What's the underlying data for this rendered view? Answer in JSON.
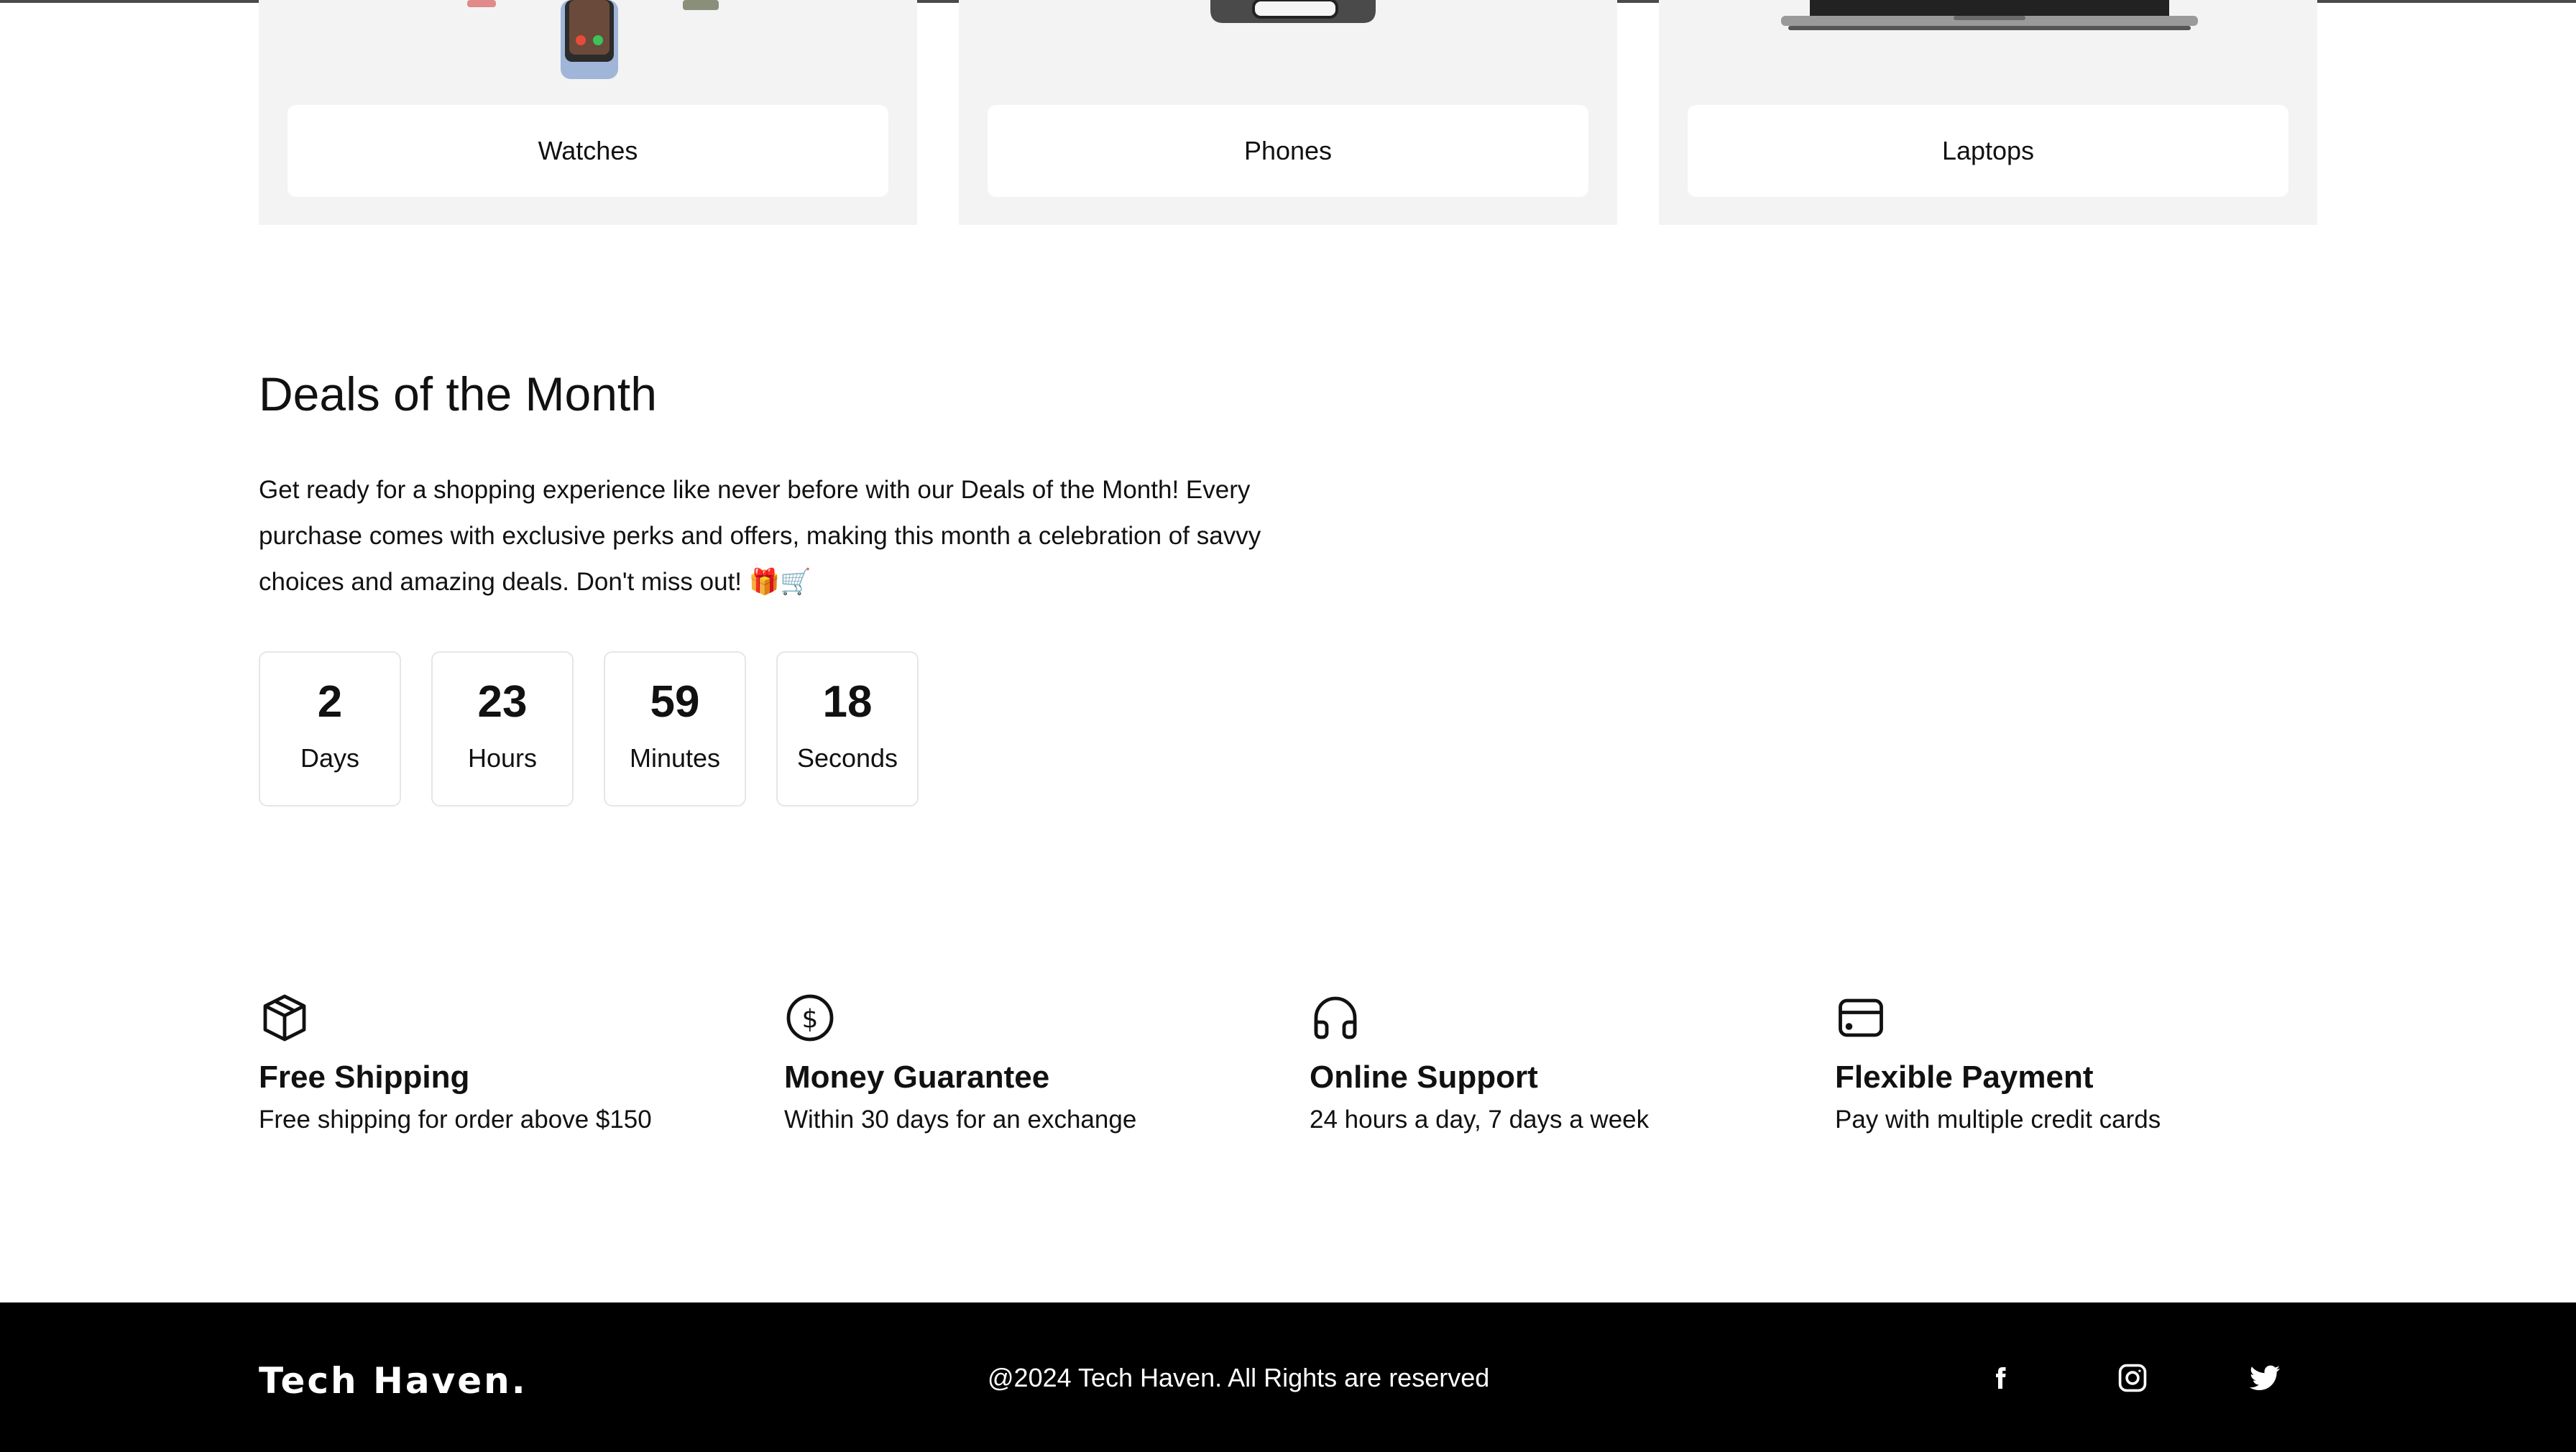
{
  "categories": [
    {
      "label": "Watches",
      "image_icon": "smartwatch-image"
    },
    {
      "label": "Phones",
      "image_icon": "phone-image"
    },
    {
      "label": "Laptops",
      "image_icon": "laptop-image"
    }
  ],
  "deals": {
    "title": "Deals of the Month",
    "description": "Get ready for a shopping experience like never before with our Deals of the Month! Every purchase comes with exclusive perks and offers, making this month a celebration of savvy choices and amazing deals. Don't miss out! 🎁🛒",
    "countdown": [
      {
        "value": "2",
        "unit": "Days"
      },
      {
        "value": "23",
        "unit": "Hours"
      },
      {
        "value": "59",
        "unit": "Minutes"
      },
      {
        "value": "18",
        "unit": "Seconds"
      }
    ]
  },
  "features": [
    {
      "icon": "package-icon",
      "title": "Free Shipping",
      "description": "Free shipping for order above $150"
    },
    {
      "icon": "dollar-circle-icon",
      "title": "Money Guarantee",
      "description": "Within 30 days for an exchange"
    },
    {
      "icon": "headphones-icon",
      "title": "Online Support",
      "description": "24 hours a day, 7 days a week"
    },
    {
      "icon": "credit-card-icon",
      "title": "Flexible Payment",
      "description": "Pay with multiple credit cards"
    }
  ],
  "footer": {
    "brand": "Tech Haven.",
    "copyright": "@2024 Tech Haven. All Rights are reserved",
    "social": [
      "facebook-icon",
      "instagram-icon",
      "twitter-icon"
    ]
  },
  "colors": {
    "card_bg": "#f3f3f3",
    "footer_bg": "#000000",
    "text": "#111111"
  }
}
